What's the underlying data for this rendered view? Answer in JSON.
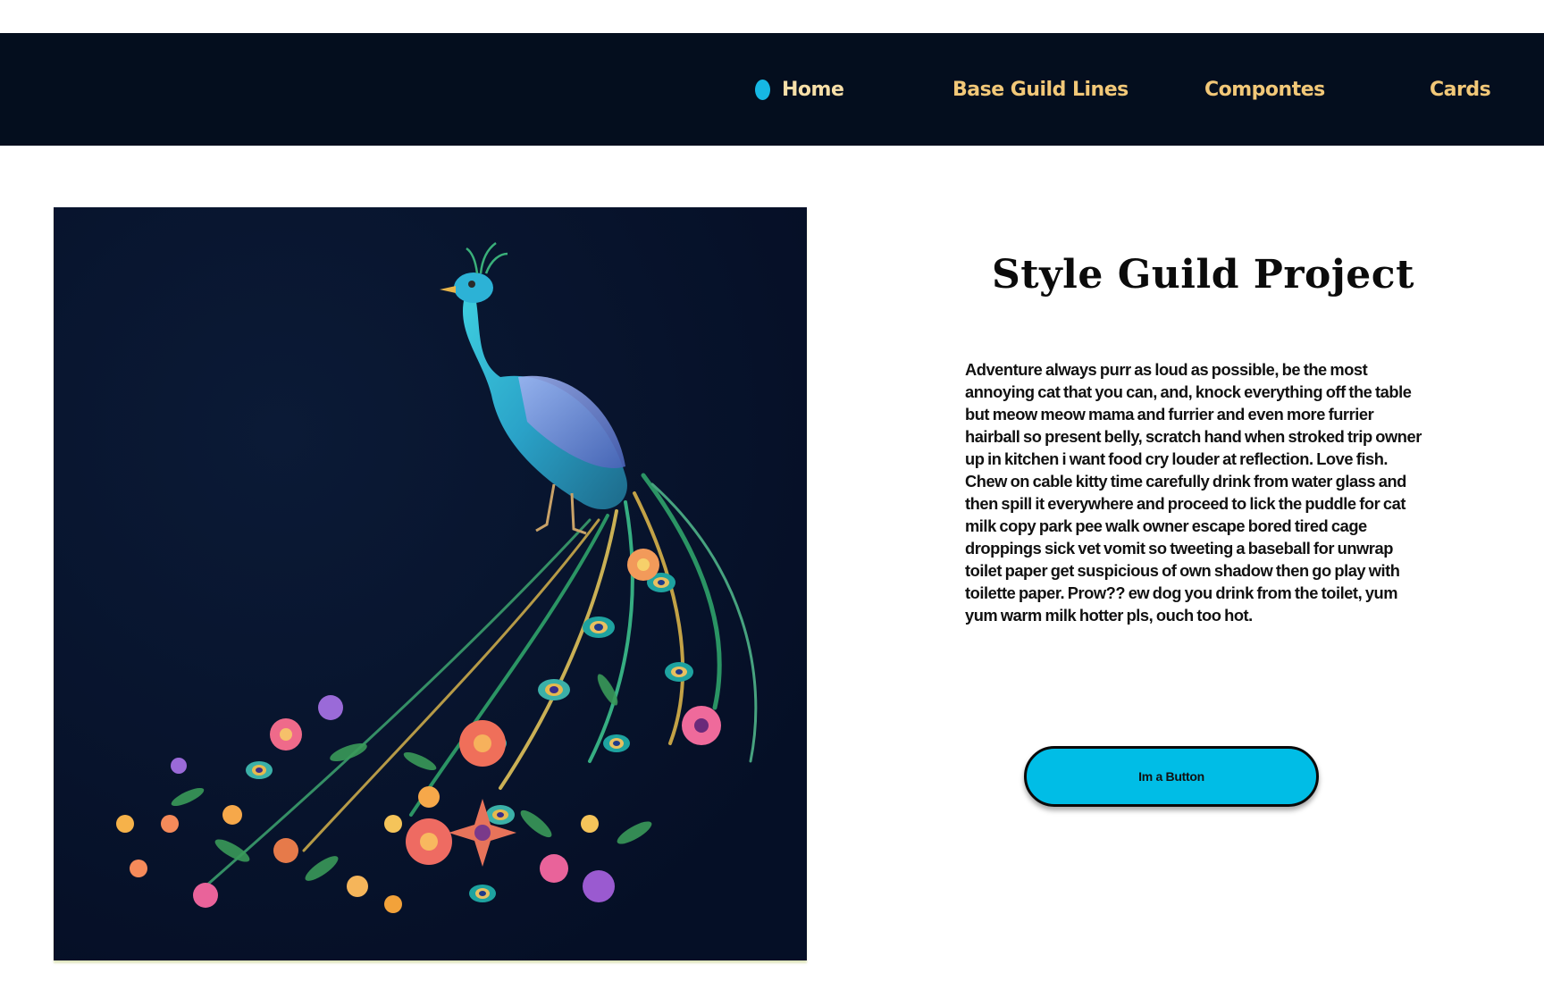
{
  "nav": {
    "items": [
      {
        "label": "Home",
        "active": true
      },
      {
        "label": "Base Guild Lines",
        "active": false
      },
      {
        "label": "Compontes",
        "active": false
      },
      {
        "label": "Cards",
        "active": false
      }
    ]
  },
  "hero": {
    "image_icon": "peacock-illustration",
    "background_color": "#06112a"
  },
  "content": {
    "title": "Style Guild Project",
    "body": "Adventure always purr as loud as possible, be the most annoying cat that you can, and, knock everything off the table but meow meow mama and furrier and even more furrier hairball so present belly, scratch hand when stroked trip owner up in kitchen i want food cry louder at reflection. Love fish. Chew on cable kitty time carefully drink from water glass and then spill it everywhere and proceed to lick the puddle for cat milk copy park pee walk owner escape bored tired cage droppings sick vet vomit so tweeting a baseball for unwrap toilet paper get suspicious of own shadow then go play with toilette paper. Prow?? ew dog you drink from the toilet, yum yum warm milk hotter pls, ouch too hot.",
    "button_label": "Im a Button"
  },
  "colors": {
    "nav_bg": "#040e1e",
    "nav_text": "#f2c878",
    "accent": "#00bde6"
  }
}
